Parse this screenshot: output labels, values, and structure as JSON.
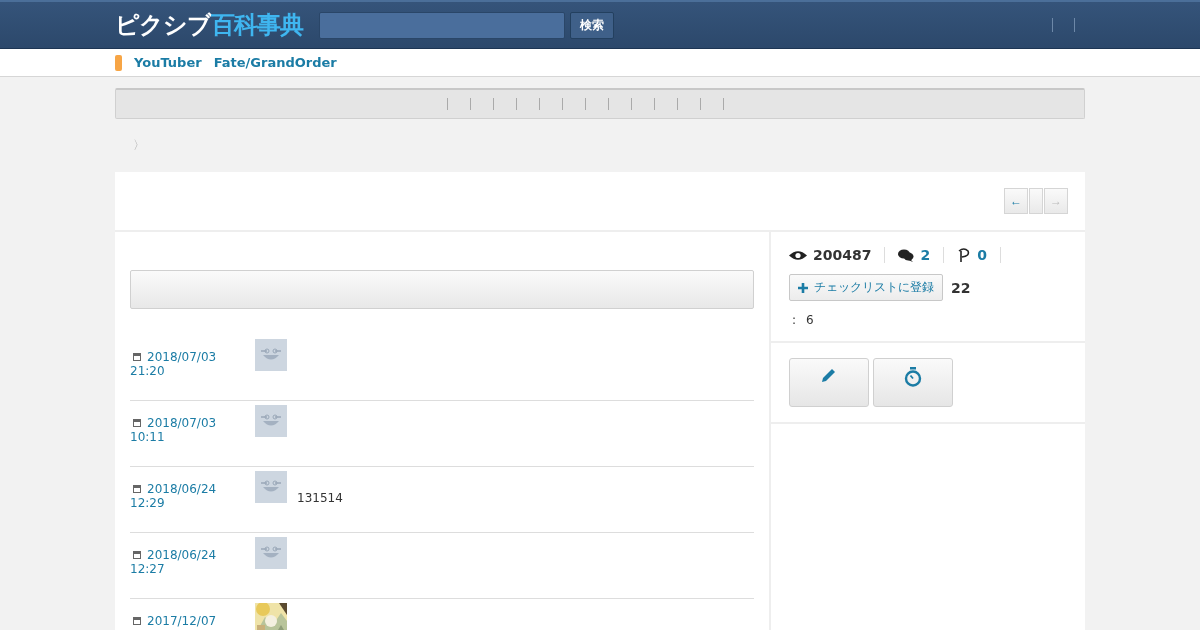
{
  "header": {
    "logo_left": "ピクシブ",
    "logo_right": "百科事典",
    "search_button": "検索"
  },
  "tags": [
    {
      "label": "YouTuber"
    },
    {
      "label": "Fate/GrandOrder"
    }
  ],
  "breadcrumb": "〉",
  "pager": {
    "prev": "←",
    "next": "→"
  },
  "stats": {
    "views": "200487",
    "comments": "2",
    "pics": "0"
  },
  "checklist": {
    "button": "チェックリストに登録",
    "count": "22"
  },
  "info": {
    "colon": ":",
    "value": "6"
  },
  "rows": [
    {
      "date": "2018/07/03",
      "time": "21:20",
      "kind": "avatar"
    },
    {
      "date": "2018/07/03",
      "time": "10:11",
      "kind": "avatar"
    },
    {
      "date": "2018/06/24",
      "time": "12:29",
      "kind": "avatar",
      "text": "131514"
    },
    {
      "date": "2018/06/24",
      "time": "12:27",
      "kind": "avatar"
    },
    {
      "date": "2017/12/07",
      "kind": "picture"
    }
  ]
}
